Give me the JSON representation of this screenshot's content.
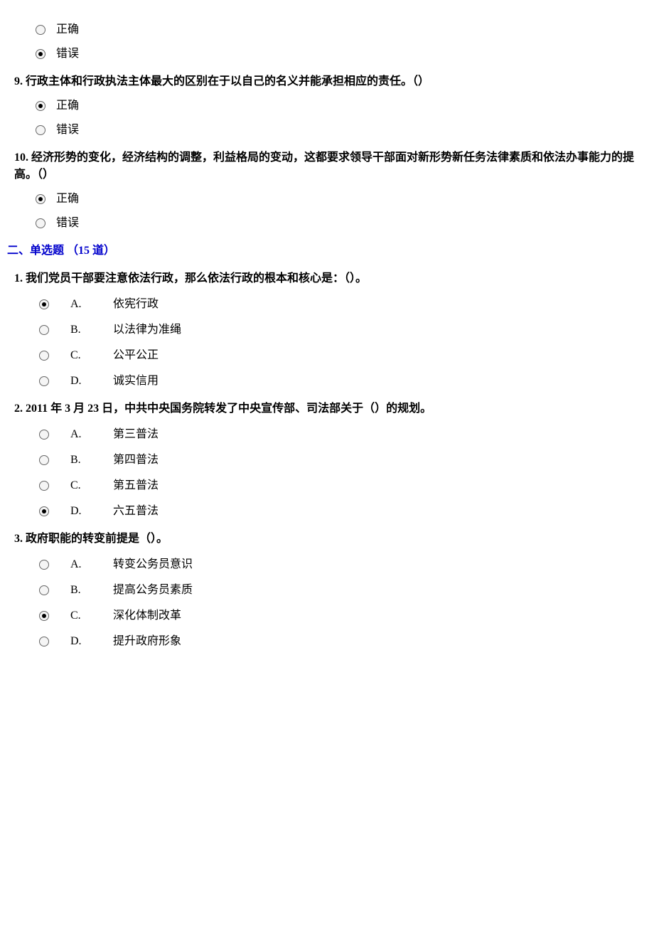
{
  "tf_q8": {
    "correct": "正确",
    "wrong": "错误",
    "selected": "wrong"
  },
  "tf_q9": {
    "num": "9.",
    "text": "行政主体和行政执法主体最大的区别在于以自己的名义并能承担相应的责任。（）",
    "correct": "正确",
    "wrong": "错误",
    "selected": "correct"
  },
  "tf_q10": {
    "num": "10.",
    "text": "经济形势的变化，经济结构的调整，利益格局的变动，这都要求领导干部面对新形势新任务法律素质和依法办事能力的提高。（）",
    "correct": "正确",
    "wrong": "错误",
    "selected": "correct"
  },
  "section2": {
    "header": "二、单选题 （15 道）"
  },
  "mc_q1": {
    "num": "1.",
    "text": "我们党员干部要注意依法行政，那么依法行政的根本和核心是：（）。",
    "options": [
      {
        "letter": "A.",
        "text": "依宪行政"
      },
      {
        "letter": "B.",
        "text": "以法律为准绳"
      },
      {
        "letter": "C.",
        "text": "公平公正"
      },
      {
        "letter": "D.",
        "text": "诚实信用"
      }
    ],
    "selected": 0
  },
  "mc_q2": {
    "num": "2.",
    "text": "2011 年 3 月 23 日，中共中央国务院转发了中央宣传部、司法部关于（）的规划。",
    "options": [
      {
        "letter": "A.",
        "text": "第三普法"
      },
      {
        "letter": "B.",
        "text": "第四普法"
      },
      {
        "letter": "C.",
        "text": "第五普法"
      },
      {
        "letter": "D.",
        "text": "六五普法"
      }
    ],
    "selected": 3
  },
  "mc_q3": {
    "num": "3.",
    "text": "政府职能的转变前提是（）。",
    "options": [
      {
        "letter": "A.",
        "text": "转变公务员意识"
      },
      {
        "letter": "B.",
        "text": "提高公务员素质"
      },
      {
        "letter": "C.",
        "text": "深化体制改革"
      },
      {
        "letter": "D.",
        "text": "提升政府形象"
      }
    ],
    "selected": 2
  }
}
